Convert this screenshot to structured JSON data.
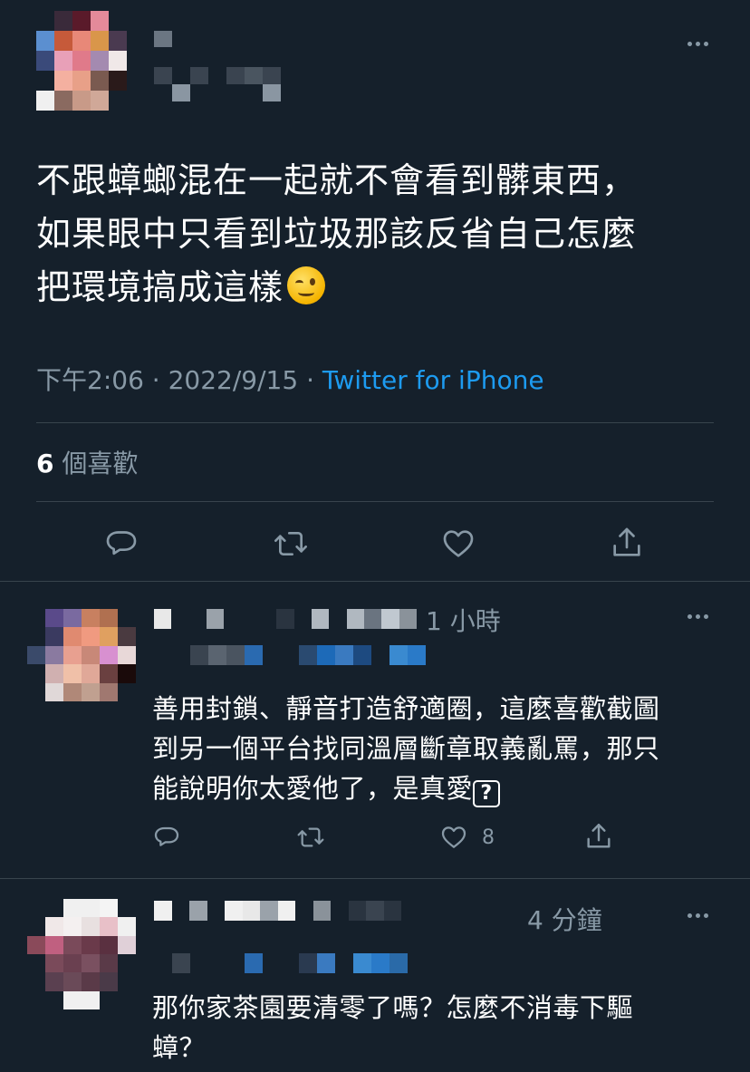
{
  "main_tweet": {
    "text_lines": [
      "不跟蟑螂混在一起就不會看到髒東西，",
      "如果眼中只看到垃圾那該反省自己怎麼",
      "把環境搞成這樣"
    ],
    "emoji": "winking-face-emoji",
    "time": "下午2:06",
    "sep": "·",
    "date": "2022/9/15",
    "source": "Twitter for iPhone",
    "likes_count": "6",
    "likes_label": "個喜歡"
  },
  "replies": [
    {
      "time": "1 小時",
      "text_lines": [
        "善用封鎖、靜音打造舒適圈，這麼喜歡截圖",
        "到另一個平台找同溫層斷章取義亂罵，那只",
        "能說明你太愛他了，是真愛"
      ],
      "trailing_icon": "question-mark-box-icon",
      "like_count": "8"
    },
    {
      "time": "4 分鐘",
      "text_lines": [
        "那你家茶園要清零了嗎？怎麼不消毒下驅",
        "蟑？"
      ]
    }
  ],
  "colors": {
    "background": "#15202b",
    "text": "#ffffff",
    "muted": "#8899a6",
    "link": "#1d9bf0",
    "divider": "#38444d"
  }
}
